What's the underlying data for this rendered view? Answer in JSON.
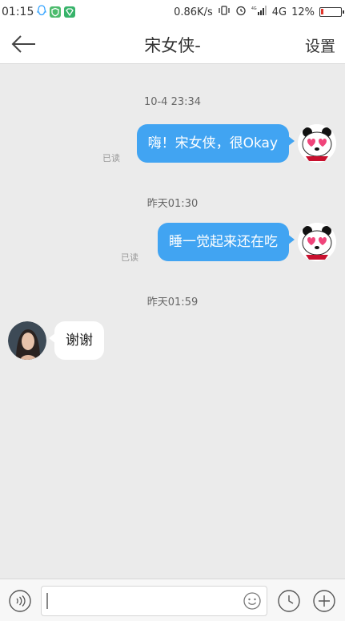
{
  "status_bar": {
    "time": "01:15",
    "network_speed": "0.86K/s",
    "network_type": "4G",
    "battery_percent": "12%",
    "battery_level": 0.12
  },
  "header": {
    "title": "宋女侠-",
    "settings_label": "设置"
  },
  "messages": [
    {
      "timestamp": "10-4 23:34",
      "text": "嗨！宋女侠，很Okay",
      "direction": "out",
      "read_label": "已读"
    },
    {
      "timestamp": "昨天01:30",
      "text": "睡一觉起来还在吃",
      "direction": "out",
      "read_label": "已读"
    },
    {
      "timestamp": "昨天01:59",
      "text": "谢谢",
      "direction": "in"
    }
  ],
  "input": {
    "placeholder": ""
  },
  "colors": {
    "bubble_out": "#41a4f2",
    "background": "#ebebeb"
  }
}
